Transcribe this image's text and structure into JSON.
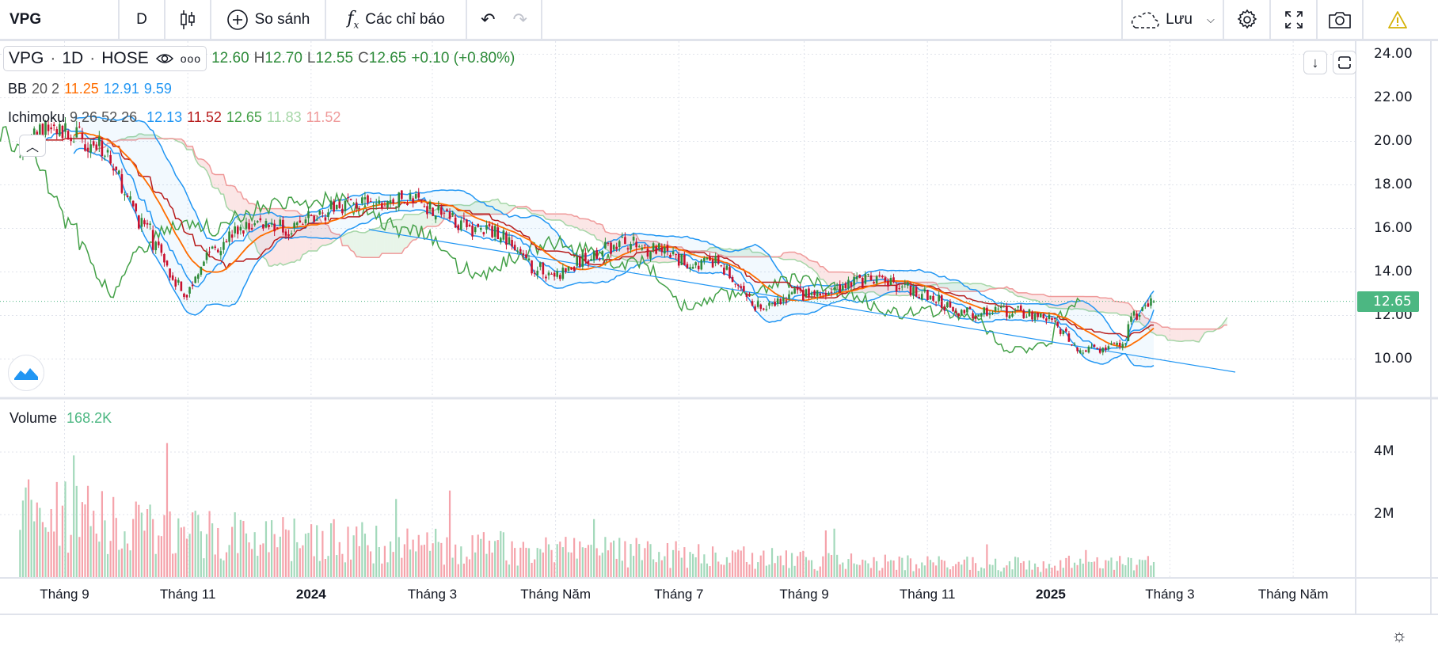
{
  "toolbar": {
    "symbol": "VPG",
    "interval": "D",
    "compare_label": "So sánh",
    "indicators_label": "Các chỉ báo",
    "save_label": "Lưu"
  },
  "legend": {
    "symbol": "VPG",
    "interval": "1D",
    "exchange": "HOSE",
    "open": "12.60",
    "high_prefix": "H",
    "high": "12.70",
    "low_prefix": "L",
    "low": "12.55",
    "close_prefix": "C",
    "close": "12.65",
    "change": "+0.10 (+0.80%)",
    "bb": {
      "name": "BB",
      "params": "20 2",
      "basis": "11.25",
      "upper": "12.91",
      "lower": "9.59"
    },
    "ichimoku": {
      "name": "Ichimoku",
      "params": "9 26 52 26",
      "conversion": "12.13",
      "base": "11.52",
      "lagging": "12.65",
      "lead1": "11.83",
      "lead2": "11.52"
    },
    "volume": {
      "name": "Volume",
      "value": "168.2K"
    }
  },
  "price_axis": [
    "24.00",
    "22.00",
    "20.00",
    "18.00",
    "16.00",
    "14.00",
    "12.00",
    "10.00"
  ],
  "current_price": "12.65",
  "volume_axis": [
    "4M",
    "2M"
  ],
  "time_axis": [
    {
      "label": "Tháng 9",
      "date": "2023-09-01",
      "bold": false
    },
    {
      "label": "Tháng 11",
      "date": "2023-11-01",
      "bold": false
    },
    {
      "label": "2024",
      "date": "2024-01-01",
      "bold": true
    },
    {
      "label": "Tháng 3",
      "date": "2024-03-01",
      "bold": false
    },
    {
      "label": "Tháng Năm",
      "date": "2024-05-01",
      "bold": false
    },
    {
      "label": "Tháng 7",
      "date": "2024-07-01",
      "bold": false
    },
    {
      "label": "Tháng 9",
      "date": "2024-09-01",
      "bold": false
    },
    {
      "label": "Tháng 11",
      "date": "2024-11-01",
      "bold": false
    },
    {
      "label": "2025",
      "date": "2025-01-01",
      "bold": true
    },
    {
      "label": "Tháng 3",
      "date": "2025-03-01",
      "bold": false
    },
    {
      "label": "Tháng Năm",
      "date": "2025-05-01",
      "bold": false
    }
  ],
  "colors": {
    "up": "#2e8b3a",
    "down": "#c8102e",
    "vol_up": "#a3d9bb",
    "vol_down": "#f5a3ab",
    "bb": "#2196f3",
    "bb_basis": "#ff6d00",
    "tenkan": "#2196f3",
    "kijun": "#b71c1c",
    "chikou": "#43a047",
    "lead1": "#a5d6a7",
    "lead2": "#ef9a9a",
    "price_tag": "#4cb782"
  },
  "chart_data": {
    "type": "candlestick",
    "symbol": "VPG",
    "interval": "1D",
    "close_anchors": [
      [
        "2023-08-10",
        19.8
      ],
      [
        "2023-08-25",
        20.6
      ],
      [
        "2023-09-08",
        20.2
      ],
      [
        "2023-09-22",
        19.6
      ],
      [
        "2023-10-03",
        17.2
      ],
      [
        "2023-10-12",
        16.0
      ],
      [
        "2023-10-24",
        14.0
      ],
      [
        "2023-10-31",
        12.8
      ],
      [
        "2023-11-10",
        14.8
      ],
      [
        "2023-11-24",
        15.8
      ],
      [
        "2023-12-08",
        16.3
      ],
      [
        "2023-12-22",
        16.0
      ],
      [
        "2024-01-05",
        16.6
      ],
      [
        "2024-01-19",
        17.2
      ],
      [
        "2024-02-02",
        17.0
      ],
      [
        "2024-02-20",
        17.4
      ],
      [
        "2024-03-05",
        16.8
      ],
      [
        "2024-03-20",
        16.0
      ],
      [
        "2024-04-05",
        15.8
      ],
      [
        "2024-04-18",
        14.3
      ],
      [
        "2024-05-03",
        13.8
      ],
      [
        "2024-05-20",
        14.8
      ],
      [
        "2024-06-05",
        15.4
      ],
      [
        "2024-06-20",
        15.0
      ],
      [
        "2024-07-05",
        14.4
      ],
      [
        "2024-07-22",
        14.4
      ],
      [
        "2024-08-05",
        12.6
      ],
      [
        "2024-08-15",
        12.3
      ],
      [
        "2024-08-28",
        13.0
      ],
      [
        "2024-09-12",
        12.9
      ],
      [
        "2024-09-25",
        13.6
      ],
      [
        "2024-10-10",
        13.6
      ],
      [
        "2024-10-25",
        13.2
      ],
      [
        "2024-11-08",
        12.6
      ],
      [
        "2024-11-22",
        12.1
      ],
      [
        "2024-12-06",
        12.2
      ],
      [
        "2024-12-20",
        12.1
      ],
      [
        "2025-01-02",
        11.8
      ],
      [
        "2025-01-10",
        10.9
      ],
      [
        "2025-01-17",
        10.4
      ],
      [
        "2025-02-05",
        10.5
      ],
      [
        "2025-02-12",
        11.9
      ],
      [
        "2025-02-21",
        12.65
      ]
    ],
    "volume_anchors": [
      [
        "2023-08-10",
        2.6
      ],
      [
        "2023-10-15",
        1.6
      ],
      [
        "2024-01-10",
        1.3
      ],
      [
        "2024-03-01",
        1.1
      ],
      [
        "2024-06-01",
        0.9
      ],
      [
        "2024-09-01",
        0.6
      ],
      [
        "2024-12-01",
        0.45
      ],
      [
        "2025-02-21",
        0.5
      ]
    ],
    "price_range": [
      8.5,
      25
    ],
    "indicators": [
      "BB 20 2",
      "Ichimoku 9 26 52 26",
      "Volume"
    ]
  }
}
